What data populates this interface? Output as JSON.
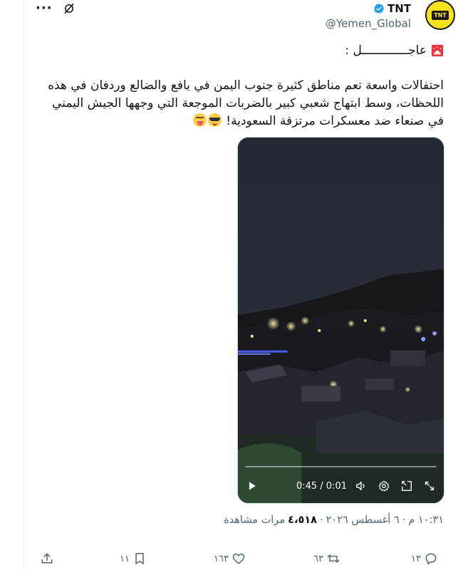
{
  "header": {
    "display_name": "TNT",
    "handle": "@Yemen_Global",
    "avatar_text": "TNT",
    "more_label": "···"
  },
  "tweet": {
    "breaking_label": "عاجـــــــــــــل :",
    "body_lines": [
      "احتفالات واسعة تعم مناطق كثيرة جنوب اليمن في يافع والضالع وردفان في هذه",
      "اللحظات، وسط ابتهاج شعبي كبير بالضربات الموجعة التي وجهها الجيش اليمني",
      "في صنعاء ضد معسكرات مرتزقة السعودية!"
    ],
    "emojis": [
      "sunglasses-emoji",
      "tongue-emoji"
    ]
  },
  "video": {
    "time_display": "0:45 / 0:01",
    "progress": 0.0,
    "controls": [
      "play-icon",
      "volume-icon",
      "settings-gear-icon",
      "picture-in-picture-icon",
      "fullscreen-icon"
    ]
  },
  "meta": {
    "time": "١٠:٣١ م",
    "date": "٦ أغسطس ٢٠٢٦",
    "views_count": "٤،٥١٨",
    "views_label": "مرات مشاهدة",
    "separator": "·"
  },
  "actions": {
    "replies": "١٣",
    "reposts": "٦٣",
    "likes": "١٦٣",
    "bookmarks": "١١"
  },
  "colors": {
    "text": "#0f1419",
    "muted": "#536471",
    "verified": "#1d9bf0",
    "avatar_bg": "#f7e21d",
    "border": "#cfd9de"
  }
}
